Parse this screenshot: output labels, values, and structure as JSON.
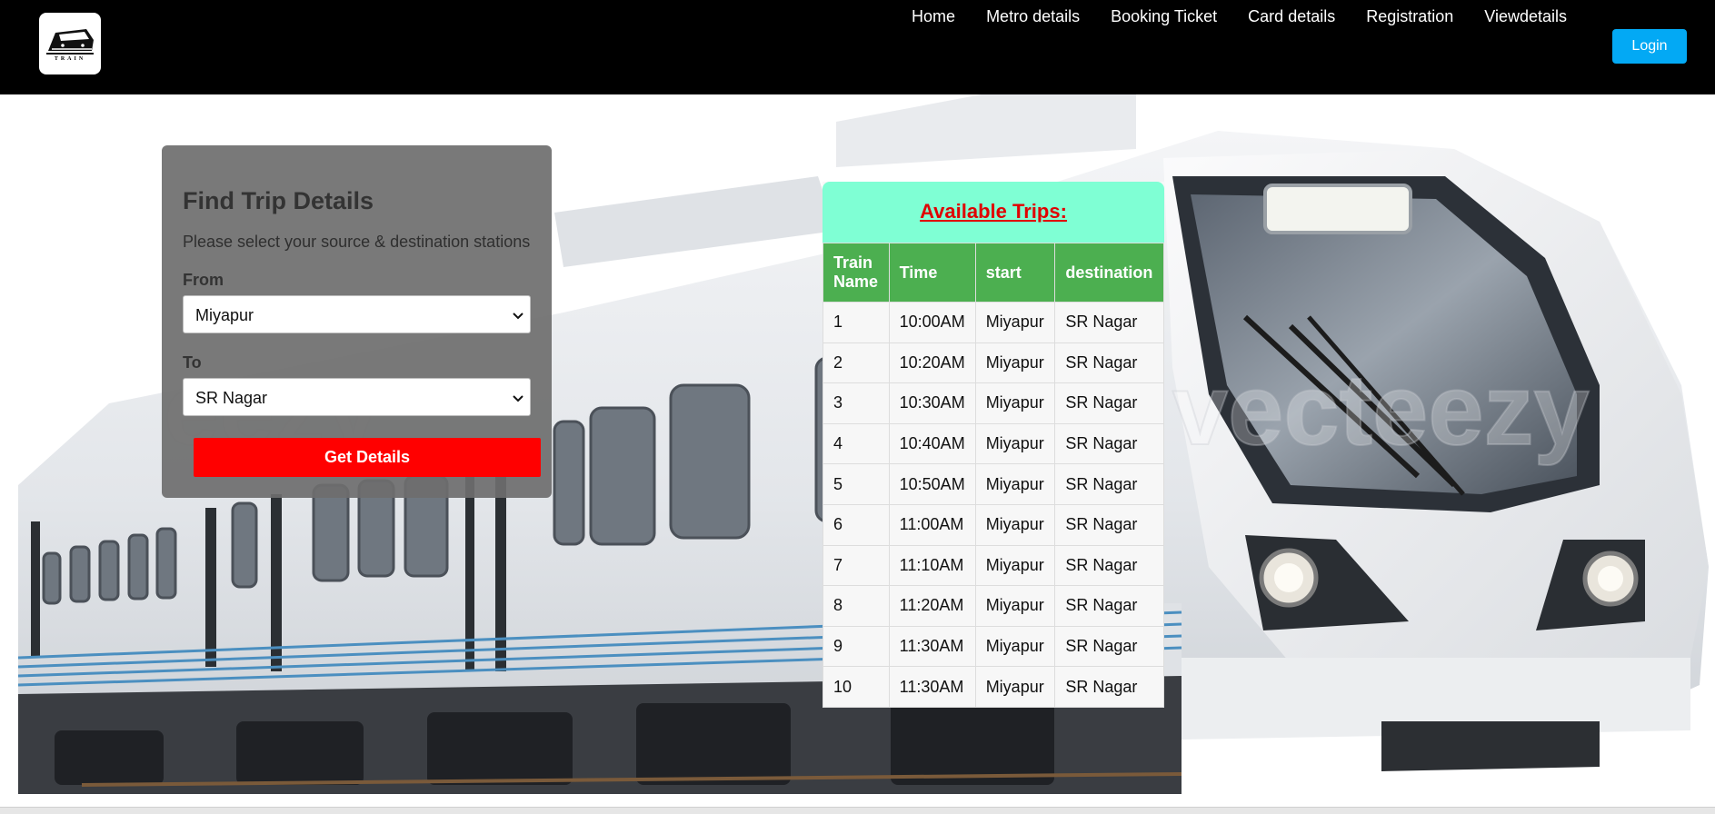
{
  "header": {
    "logo_text": "TRAIN",
    "nav": [
      {
        "label": "Home"
      },
      {
        "label": "Metro details"
      },
      {
        "label": "Booking Ticket"
      },
      {
        "label": "Card details"
      },
      {
        "label": "Registration"
      },
      {
        "label": "Viewdetails"
      }
    ],
    "login_label": "Login",
    "login_color": "#03a9f4"
  },
  "background": {
    "watermark_text": "vecteezy",
    "watermark_text_2": "eezy"
  },
  "trip_form": {
    "title": "Find Trip Details",
    "subtitle": "Please select your source & destination stations",
    "from_label": "From",
    "from_value": "Miyapur",
    "to_label": "To",
    "to_value": "SR Nagar",
    "submit_label": "Get Details",
    "submit_color": "#ff0000"
  },
  "trips": {
    "title": "Available Trips:",
    "columns": [
      "Train Name",
      "Time",
      "start",
      "destination"
    ],
    "rows": [
      [
        "1",
        "10:00AM",
        "Miyapur",
        "SR Nagar"
      ],
      [
        "2",
        "10:20AM",
        "Miyapur",
        "SR Nagar"
      ],
      [
        "3",
        "10:30AM",
        "Miyapur",
        "SR Nagar"
      ],
      [
        "4",
        "10:40AM",
        "Miyapur",
        "SR Nagar"
      ],
      [
        "5",
        "10:50AM",
        "Miyapur",
        "SR Nagar"
      ],
      [
        "6",
        "11:00AM",
        "Miyapur",
        "SR Nagar"
      ],
      [
        "7",
        "11:10AM",
        "Miyapur",
        "SR Nagar"
      ],
      [
        "8",
        "11:20AM",
        "Miyapur",
        "SR Nagar"
      ],
      [
        "9",
        "11:30AM",
        "Miyapur",
        "SR Nagar"
      ],
      [
        "10",
        "11:30AM",
        "Miyapur",
        "SR Nagar"
      ]
    ],
    "header_color": "#4caf50",
    "title_bar_color": "#7fffd4"
  }
}
